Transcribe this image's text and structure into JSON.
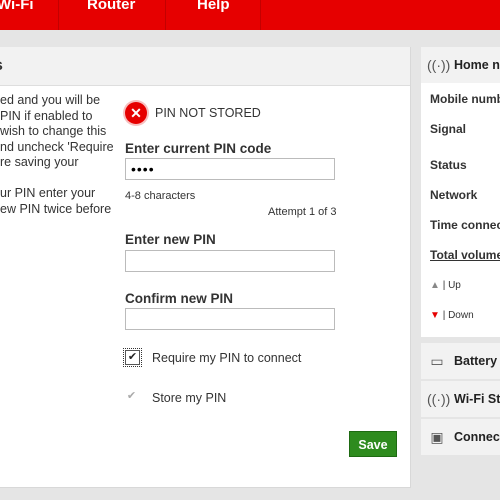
{
  "nav": {
    "tabs": [
      "Wi-Fi",
      "Router",
      "Help"
    ]
  },
  "panel": {
    "title": "s",
    "description": [
      "ed and you will be",
      "PIN if enabled to",
      " wish to change this",
      "nd uncheck 'Require",
      "re saving your",
      "",
      "ur PIN enter your",
      "ew PIN twice before"
    ]
  },
  "pin": {
    "status": "PIN NOT STORED",
    "current_label": "Enter current PIN code",
    "current_value": "••••",
    "hint": "4-8 characters",
    "attempt": "Attempt 1 of 3",
    "new_label": "Enter new PIN",
    "confirm_label": "Confirm new PIN",
    "require_label": "Require my PIN to connect",
    "require_checked": true,
    "store_label": "Store my PIN",
    "store_checked": true,
    "save_label": "Save"
  },
  "sidebar": {
    "home": {
      "title": "Home ne",
      "items": [
        "Mobile numb",
        "Signal",
        "Status",
        "Network",
        "Time connec"
      ],
      "total_volume": "Total volume",
      "up": "| Up",
      "down": "| Down"
    },
    "battery": "Battery",
    "wifi": "Wi-Fi Sta",
    "connect": "Connect"
  },
  "colors": {
    "brand_red": "#e60000",
    "save_green": "#2e8b1e"
  }
}
